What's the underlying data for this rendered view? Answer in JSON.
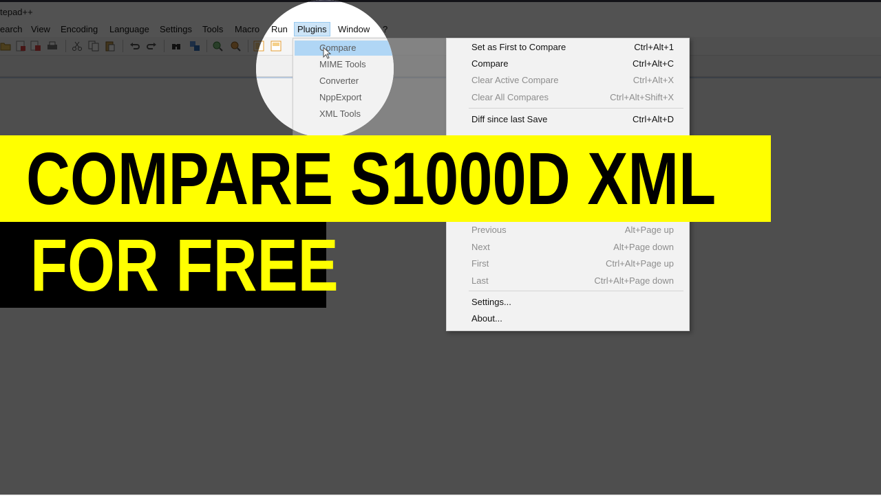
{
  "window": {
    "title": "tepad++"
  },
  "menubar": {
    "items": [
      "earch",
      "View",
      "Encoding",
      "Language",
      "Settings",
      "Tools",
      "Macro",
      "Run",
      "Plugins",
      "Window",
      "?"
    ]
  },
  "toolbar": {
    "icons": [
      "open-file-icon",
      "save-icon",
      "save-all-icon",
      "print-icon",
      "cut-icon",
      "copy-icon",
      "paste-icon",
      "undo-icon",
      "redo-icon",
      "find-icon",
      "replace-icon",
      "zoom-in-icon",
      "zoom-out-icon",
      "sync-vertical-icon",
      "sync-horizontal-icon"
    ]
  },
  "plugins_menu": {
    "items": [
      {
        "label": "Compare",
        "has_submenu": true
      },
      {
        "label": "MIME Tools",
        "has_submenu": true
      },
      {
        "label": "Converter",
        "has_submenu": true
      },
      {
        "label": "NppExport",
        "has_submenu": true
      },
      {
        "label": "XML Tools",
        "has_submenu": true
      }
    ]
  },
  "compare_menu": {
    "items": [
      {
        "label": "Set as First to Compare",
        "shortcut": "Ctrl+Alt+1",
        "enabled": true
      },
      {
        "label": "Compare",
        "shortcut": "Ctrl+Alt+C",
        "enabled": true
      },
      {
        "label": "Clear Active Compare",
        "shortcut": "Ctrl+Alt+X",
        "enabled": false
      },
      {
        "label": "Clear All Compares",
        "shortcut": "Ctrl+Alt+Shift+X",
        "enabled": false
      },
      {
        "label": "Diff since last Save",
        "shortcut": "Ctrl+Alt+D",
        "enabled": true
      },
      {
        "label": "Previous",
        "shortcut": "Alt+Page up",
        "enabled": false
      },
      {
        "label": "Next",
        "shortcut": "Alt+Page down",
        "enabled": false
      },
      {
        "label": "First",
        "shortcut": "Ctrl+Alt+Page up",
        "enabled": false
      },
      {
        "label": "Last",
        "shortcut": "Ctrl+Alt+Page down",
        "enabled": false
      },
      {
        "label": "Settings...",
        "shortcut": "",
        "enabled": true
      },
      {
        "label": "About...",
        "shortcut": "",
        "enabled": true
      }
    ]
  },
  "overlay": {
    "headline": "COMPARE S1000D XML",
    "subline": "FOR FREE",
    "headline_bg": "#ffff00",
    "subline_bg": "#000000"
  },
  "colors": {
    "highlight": "#91c9f7",
    "menu_bg": "#f2f2f2",
    "disabled_text": "#8d8d8d"
  }
}
